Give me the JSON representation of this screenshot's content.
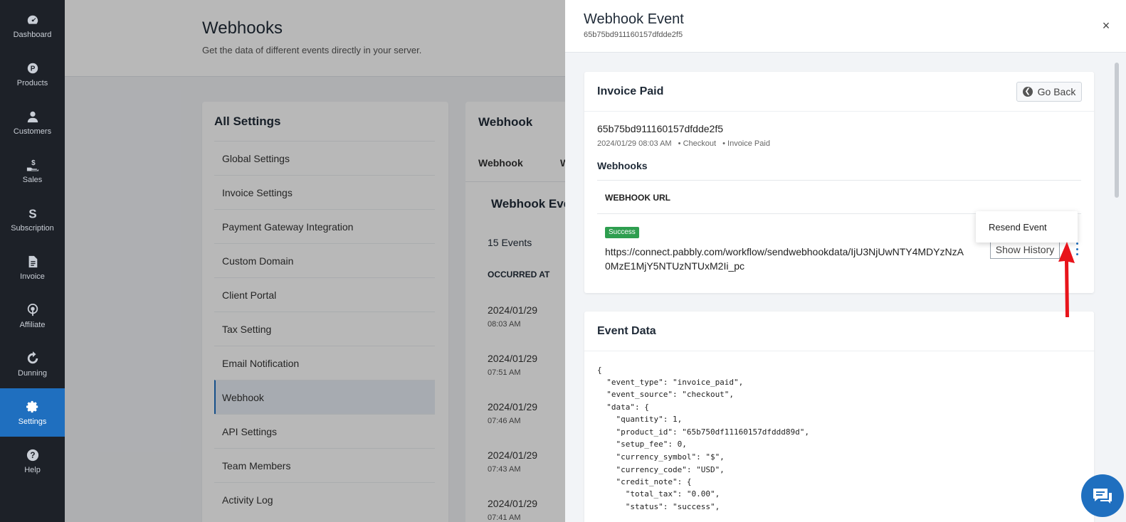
{
  "sidebar": {
    "items": [
      {
        "label": "Dashboard",
        "icon": "dashboard-icon"
      },
      {
        "label": "Products",
        "icon": "products-icon"
      },
      {
        "label": "Customers",
        "icon": "customers-icon"
      },
      {
        "label": "Sales",
        "icon": "sales-icon"
      },
      {
        "label": "Subscription",
        "icon": "subscription-icon"
      },
      {
        "label": "Invoice",
        "icon": "invoice-icon"
      },
      {
        "label": "Affiliate",
        "icon": "affiliate-icon"
      },
      {
        "label": "Dunning",
        "icon": "dunning-icon"
      },
      {
        "label": "Settings",
        "icon": "gear-icon"
      },
      {
        "label": "Help",
        "icon": "help-icon"
      }
    ],
    "active": "Settings",
    "active_color": "#1f6fbf"
  },
  "page": {
    "title": "Webhooks",
    "subtitle": "Get the data of different events directly in your server."
  },
  "settings": {
    "title": "All Settings",
    "items": [
      "Global Settings",
      "Invoice Settings",
      "Payment Gateway Integration",
      "Custom Domain",
      "Client Portal",
      "Tax Setting",
      "Email Notification",
      "Webhook",
      "API Settings",
      "Team Members",
      "Activity Log"
    ],
    "active": "Webhook"
  },
  "webhook_panel": {
    "title": "Webhook",
    "tab1": "Webhook",
    "tab2": "W",
    "section_title": "Webhook Eve",
    "count": "15 Events",
    "column": "OCCURRED AT",
    "rows": [
      {
        "date": "2024/01/29",
        "time": "08:03 AM"
      },
      {
        "date": "2024/01/29",
        "time": "07:51 AM"
      },
      {
        "date": "2024/01/29",
        "time": "07:46 AM"
      },
      {
        "date": "2024/01/29",
        "time": "07:43 AM"
      },
      {
        "date": "2024/01/29",
        "time": "07:41 AM"
      }
    ]
  },
  "drawer": {
    "title": "Webhook Event",
    "id": "65b75bd911160157dfdde2f5",
    "close": "×",
    "card": {
      "title": "Invoice Paid",
      "go_back": "Go Back",
      "event_id": "65b75bd911160157dfdde2f5",
      "timestamp": "2024/01/29 08:03 AM",
      "source": "• Checkout",
      "type": "• Invoice Paid",
      "webhooks_label": "Webhooks",
      "table_header": "WEBHOOK URL",
      "status": "Success",
      "status_color": "#2e9e4f",
      "url": "https://connect.pabbly.com/workflow/sendwebhookdata/IjU3NjUwNTY4MDYzNzA0MzE1MjY5NTUzNTUxM2Ii_pc",
      "show_history": "Show History",
      "menu": {
        "item": "Resend Event"
      }
    },
    "event_data": {
      "title": "Event Data",
      "lines": [
        "{",
        "  \"event_type\": \"invoice_paid\",",
        "  \"event_source\": \"checkout\",",
        "  \"data\": {",
        "    \"quantity\": 1,",
        "    \"product_id\": \"65b750df11160157dfddd89d\",",
        "    \"setup_fee\": 0,",
        "    \"currency_symbol\": \"$\",",
        "    \"currency_code\": \"USD\",",
        "    \"credit_note\": {",
        "      \"total_tax\": \"0.00\",",
        "      \"status\": \"success\","
      ]
    }
  },
  "annotation_color": "#e8141b"
}
